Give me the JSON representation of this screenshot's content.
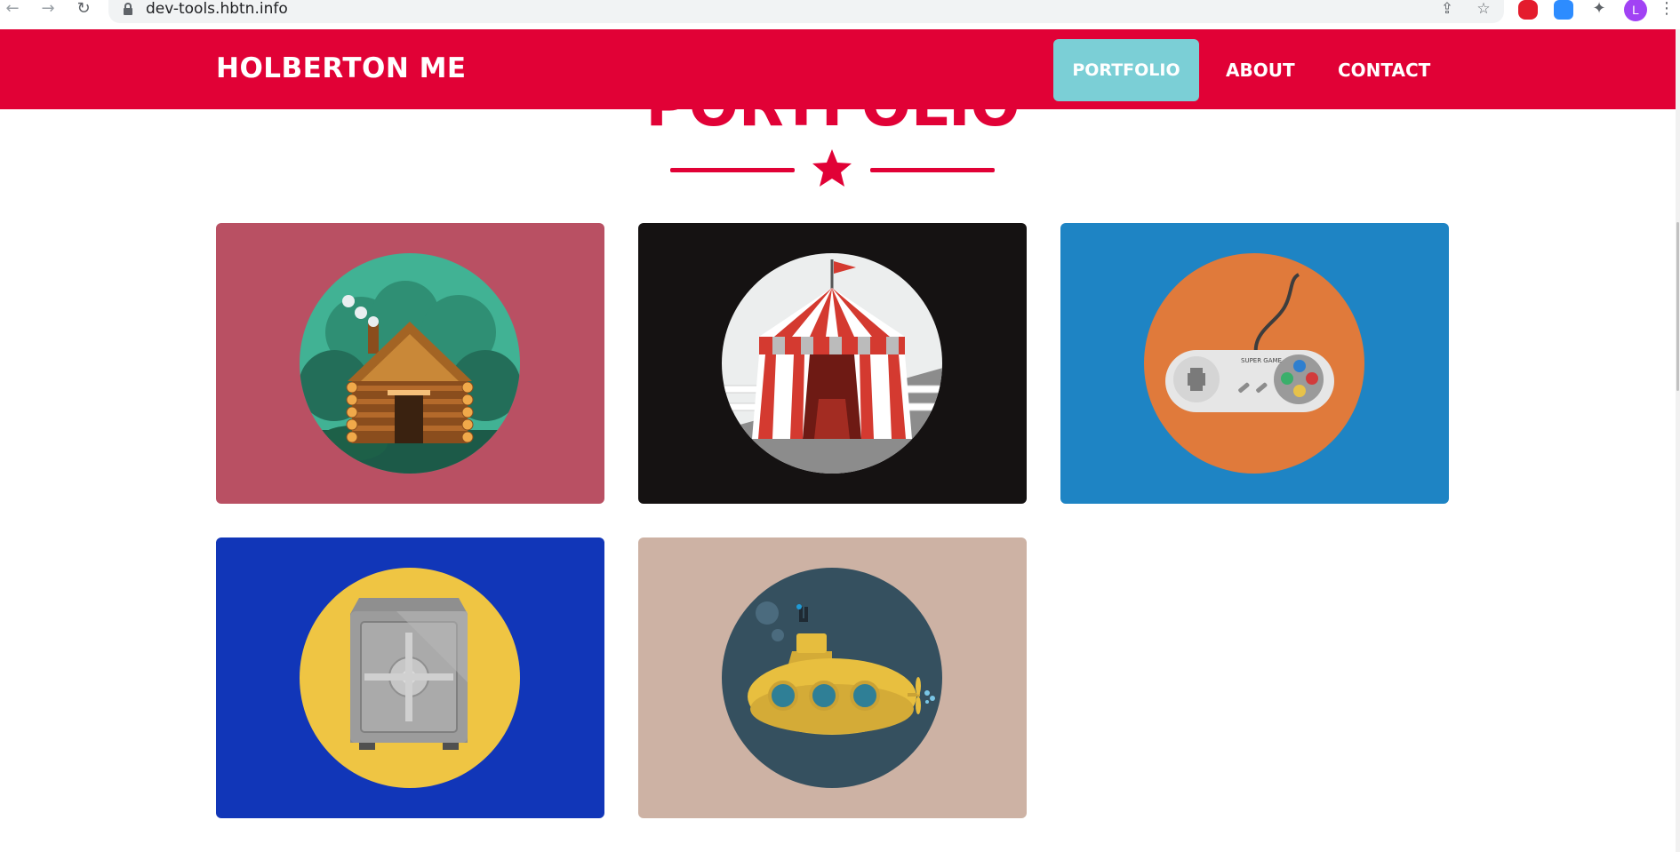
{
  "browser": {
    "url": "dev-tools.hbtn.info",
    "avatar_letter": "L"
  },
  "header": {
    "brand": "HOLBERTON ME",
    "nav": [
      {
        "label": "PORTFOLIO",
        "active": true
      },
      {
        "label": "ABOUT",
        "active": false
      },
      {
        "label": "CONTACT",
        "active": false
      }
    ]
  },
  "section": {
    "title": "PORTFOLIO"
  },
  "portfolio": {
    "items": [
      {
        "subject": "log-cabin",
        "background": "#b95063"
      },
      {
        "subject": "circus-tent",
        "background": "#151212"
      },
      {
        "subject": "game-controller",
        "background": "#1e84c4",
        "text": "SUPER GAME"
      },
      {
        "subject": "safe",
        "background": "#1136b8"
      },
      {
        "subject": "submarine",
        "background": "#cdb2a4"
      }
    ]
  },
  "colors": {
    "brand_red": "#e10136",
    "active_nav": "#7bcfd6"
  }
}
